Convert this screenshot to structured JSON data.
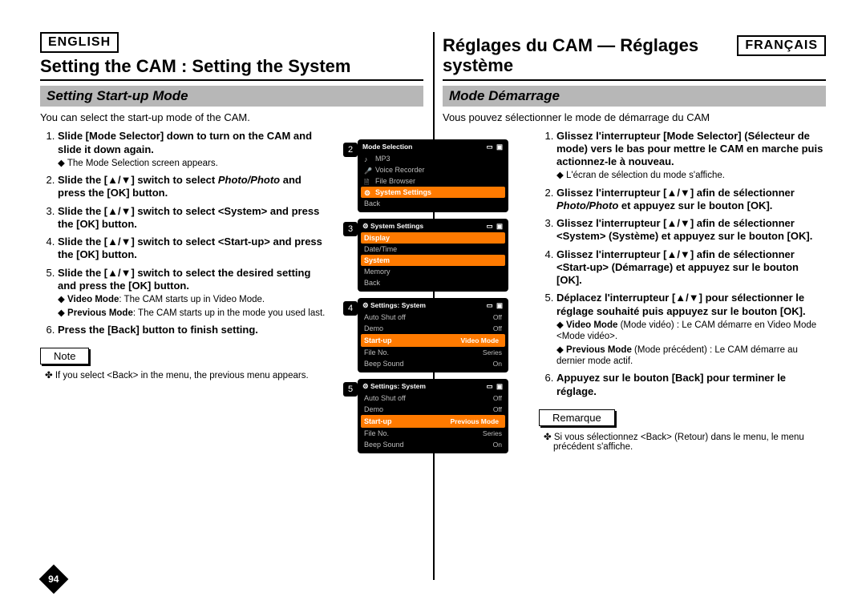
{
  "left": {
    "lang": "ENGLISH",
    "title": "Setting the CAM : Setting the System",
    "section": "Setting Start-up Mode",
    "intro": "You can select the start-up mode of the CAM.",
    "steps": [
      {
        "main": "Slide [Mode Selector] down to turn on the CAM and slide it down again.",
        "subs": [
          {
            "type": "diamond",
            "text": "The Mode Selection screen appears."
          }
        ]
      },
      {
        "main_pre": "Slide the [",
        "main_mid": "] switch to select ",
        "main_em": "Photo/Photo",
        "main_post": " and press the [OK] button."
      },
      {
        "main_pre": "Slide the [",
        "main_mid": "] switch to select <System> and press the [OK] button."
      },
      {
        "main_pre": "Slide the [",
        "main_mid": "] switch to select <Start-up> and press the [OK] button."
      },
      {
        "main_pre": "Slide the [",
        "main_mid": "] switch to select the desired setting and press the [OK] button.",
        "subs": [
          {
            "type": "diamond",
            "label": "Video Mode",
            "text": ": The CAM starts up in Video Mode."
          },
          {
            "type": "diamond",
            "label": "Previous Mode",
            "text": ": The CAM starts up in the mode you used last."
          }
        ]
      },
      {
        "main": "Press the [Back] button to finish setting."
      }
    ],
    "note_label": "Note",
    "note_text": "If you select <Back> in the menu, the previous menu appears.",
    "page_num": "94"
  },
  "right": {
    "lang": "FRANÇAIS",
    "title": "Réglages du CAM — Réglages système",
    "section": "Mode Démarrage",
    "intro": "Vous pouvez sélectionner le mode de démarrage du CAM",
    "steps": [
      {
        "main": "Glissez l'interrupteur [Mode Selector] (Sélecteur de mode) vers le bas pour mettre le CAM en marche puis actionnez-le à nouveau.",
        "subs": [
          {
            "type": "diamond",
            "text": "L'écran de sélection du mode s'affiche."
          }
        ]
      },
      {
        "main_pre": "Glissez l'interrupteur [",
        "main_mid": "] afin de sélectionner ",
        "main_em": "Photo/Photo",
        "main_post": " et appuyez sur le bouton [OK]."
      },
      {
        "main_pre": "Glissez l'interrupteur [",
        "main_mid": "] afin de sélectionner <System> (Système) et appuyez sur le bouton [OK]."
      },
      {
        "main_pre": "Glissez l'interrupteur [",
        "main_mid": "] afin de sélectionner <Start-up> (Démarrage) et appuyez sur le bouton [OK]."
      },
      {
        "main_pre": "Déplacez l'interrupteur [",
        "main_mid": "] pour sélectionner le réglage souhaité puis appuyez sur le bouton [OK].",
        "subs": [
          {
            "type": "diamond",
            "label": "Video Mode",
            "text": " (Mode vidéo) : Le CAM démarre en Video Mode <Mode vidéo>."
          },
          {
            "type": "diamond",
            "label": "Previous Mode",
            "text": " (Mode précédent) : Le CAM démarre au dernier mode actif."
          }
        ]
      },
      {
        "main": "Appuyez sur le bouton [Back] pour terminer le réglage."
      }
    ],
    "note_label": "Remarque",
    "note_text": "Si vous sélectionnez <Back> (Retour) dans le menu, le menu précédent s'affiche."
  },
  "screens": [
    {
      "num": "2",
      "title": "Mode Selection",
      "rows": [
        {
          "icon": "note",
          "label": "MP3"
        },
        {
          "icon": "mic",
          "label": "Voice Recorder"
        },
        {
          "icon": "file",
          "label": "File Browser"
        },
        {
          "icon": "gear",
          "label": "System Settings",
          "sel": true
        },
        {
          "label": "Back"
        }
      ]
    },
    {
      "num": "3",
      "title": "System Settings",
      "rows": [
        {
          "label": "Display",
          "sel": true
        },
        {
          "label": "Date/Time"
        },
        {
          "label": "System",
          "sel": true
        },
        {
          "label": "Memory"
        },
        {
          "label": "Back"
        }
      ]
    },
    {
      "num": "4",
      "title": "Settings: System",
      "rows": [
        {
          "label": "Auto Shut off",
          "val": "Off"
        },
        {
          "label": "Demo",
          "val": "Off"
        },
        {
          "label": "Start-up",
          "val": "Video Mode",
          "rowsel": true
        },
        {
          "label": "File No.",
          "val": "Series"
        },
        {
          "label": "Beep Sound",
          "val": "On"
        }
      ]
    },
    {
      "num": "5",
      "title": "Settings: System",
      "rows": [
        {
          "label": "Auto Shut off",
          "val": "Off"
        },
        {
          "label": "Demo",
          "val": "Off"
        },
        {
          "label": "Start-up",
          "val": "Previous Mode",
          "rowsel": true
        },
        {
          "label": "File No.",
          "val": "Series"
        },
        {
          "label": "Beep Sound",
          "val": "On"
        }
      ]
    }
  ],
  "status_icons": "▭ 🔲"
}
